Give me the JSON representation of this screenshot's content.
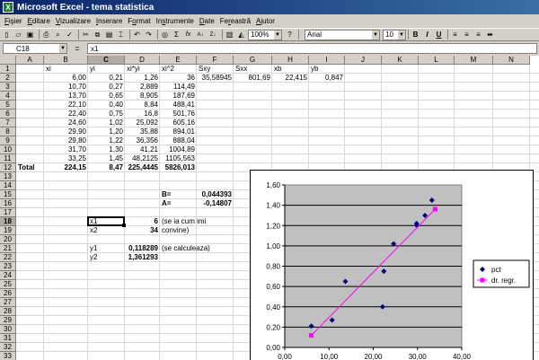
{
  "window": {
    "title": "Microsoft Excel - tema statistica",
    "app_icon": "excel-logo-icon"
  },
  "menu": [
    {
      "label": "Fişier",
      "u": "F"
    },
    {
      "label": "Editare",
      "u": "E"
    },
    {
      "label": "Vizualizare",
      "u": "V"
    },
    {
      "label": "Inserare",
      "u": "I"
    },
    {
      "label": "Format",
      "u": "o"
    },
    {
      "label": "Instrumente",
      "u": "s"
    },
    {
      "label": "Date",
      "u": "D"
    },
    {
      "label": "Fereastră",
      "u": "r"
    },
    {
      "label": "Ajutor",
      "u": "A"
    }
  ],
  "toolbar": {
    "zoom": "100%",
    "font_name": "Arial",
    "font_size": "10",
    "bold_label": "B",
    "italic_label": "I",
    "underline_label": "U",
    "sum_label": "Σ",
    "fx_label": "fx",
    "sort_asc_label": "A↓",
    "sort_desc_label": "Z↓"
  },
  "formula_bar": {
    "name_box": "C18",
    "fx_symbol": "=",
    "content": "x1"
  },
  "sheet": {
    "columns": [
      "A",
      "B",
      "C",
      "D",
      "E",
      "F",
      "G",
      "H",
      "I",
      "J",
      "K",
      "L",
      "M",
      "N"
    ],
    "selected_column": "C",
    "selected_row": "18",
    "rows": [
      "1",
      "2",
      "3",
      "4",
      "5",
      "6",
      "7",
      "8",
      "9",
      "10",
      "11",
      "12",
      "13",
      "14",
      "15",
      "16",
      "17",
      "18",
      "19",
      "20",
      "21",
      "22",
      "23",
      "24",
      "25",
      "26",
      "27",
      "28",
      "29",
      "30",
      "31",
      "32",
      "33"
    ],
    "cells": [
      {
        "col": "B",
        "row": 1,
        "v": "xi"
      },
      {
        "col": "C",
        "row": 1,
        "v": "yi"
      },
      {
        "col": "D",
        "row": 1,
        "v": "xi*yi"
      },
      {
        "col": "E",
        "row": 1,
        "v": "xi^2"
      },
      {
        "col": "F",
        "row": 1,
        "v": "Sxy"
      },
      {
        "col": "G",
        "row": 1,
        "v": "Sxx"
      },
      {
        "col": "H",
        "row": 1,
        "v": "xb"
      },
      {
        "col": "I",
        "row": 1,
        "v": "yb"
      },
      {
        "col": "B",
        "row": 2,
        "v": "6,00",
        "r": 1
      },
      {
        "col": "C",
        "row": 2,
        "v": "0,21",
        "r": 1
      },
      {
        "col": "D",
        "row": 2,
        "v": "1,26",
        "r": 1
      },
      {
        "col": "E",
        "row": 2,
        "v": "36",
        "r": 1
      },
      {
        "col": "F",
        "row": 2,
        "v": "35,58945",
        "r": 1
      },
      {
        "col": "G",
        "row": 2,
        "v": "801,69",
        "r": 1
      },
      {
        "col": "H",
        "row": 2,
        "v": "22,415",
        "r": 1
      },
      {
        "col": "I",
        "row": 2,
        "v": "0,847",
        "r": 1
      },
      {
        "col": "B",
        "row": 3,
        "v": "10,70",
        "r": 1
      },
      {
        "col": "C",
        "row": 3,
        "v": "0,27",
        "r": 1
      },
      {
        "col": "D",
        "row": 3,
        "v": "2,889",
        "r": 1
      },
      {
        "col": "E",
        "row": 3,
        "v": "114,49",
        "r": 1
      },
      {
        "col": "B",
        "row": 4,
        "v": "13,70",
        "r": 1
      },
      {
        "col": "C",
        "row": 4,
        "v": "0,65",
        "r": 1
      },
      {
        "col": "D",
        "row": 4,
        "v": "8,905",
        "r": 1
      },
      {
        "col": "E",
        "row": 4,
        "v": "187,69",
        "r": 1
      },
      {
        "col": "B",
        "row": 5,
        "v": "22,10",
        "r": 1
      },
      {
        "col": "C",
        "row": 5,
        "v": "0,40",
        "r": 1
      },
      {
        "col": "D",
        "row": 5,
        "v": "8,84",
        "r": 1
      },
      {
        "col": "E",
        "row": 5,
        "v": "488,41",
        "r": 1
      },
      {
        "col": "B",
        "row": 6,
        "v": "22,40",
        "r": 1
      },
      {
        "col": "C",
        "row": 6,
        "v": "0,75",
        "r": 1
      },
      {
        "col": "D",
        "row": 6,
        "v": "16,8",
        "r": 1
      },
      {
        "col": "E",
        "row": 6,
        "v": "501,76",
        "r": 1
      },
      {
        "col": "B",
        "row": 7,
        "v": "24,60",
        "r": 1
      },
      {
        "col": "C",
        "row": 7,
        "v": "1,02",
        "r": 1
      },
      {
        "col": "D",
        "row": 7,
        "v": "25,092",
        "r": 1
      },
      {
        "col": "E",
        "row": 7,
        "v": "605,16",
        "r": 1
      },
      {
        "col": "B",
        "row": 8,
        "v": "29,90",
        "r": 1
      },
      {
        "col": "C",
        "row": 8,
        "v": "1,20",
        "r": 1
      },
      {
        "col": "D",
        "row": 8,
        "v": "35,88",
        "r": 1
      },
      {
        "col": "E",
        "row": 8,
        "v": "894,01",
        "r": 1
      },
      {
        "col": "B",
        "row": 9,
        "v": "29,80",
        "r": 1
      },
      {
        "col": "C",
        "row": 9,
        "v": "1,22",
        "r": 1
      },
      {
        "col": "D",
        "row": 9,
        "v": "36,356",
        "r": 1
      },
      {
        "col": "E",
        "row": 9,
        "v": "888,04",
        "r": 1
      },
      {
        "col": "B",
        "row": 10,
        "v": "31,70",
        "r": 1
      },
      {
        "col": "C",
        "row": 10,
        "v": "1,30",
        "r": 1
      },
      {
        "col": "D",
        "row": 10,
        "v": "41,21",
        "r": 1
      },
      {
        "col": "E",
        "row": 10,
        "v": "1004,89",
        "r": 1
      },
      {
        "col": "B",
        "row": 11,
        "v": "33,25",
        "r": 1
      },
      {
        "col": "C",
        "row": 11,
        "v": "1,45",
        "r": 1
      },
      {
        "col": "D",
        "row": 11,
        "v": "48,2125",
        "r": 1
      },
      {
        "col": "E",
        "row": 11,
        "v": "1105,563",
        "r": 1
      },
      {
        "col": "A",
        "row": 12,
        "v": "Total",
        "b": 1
      },
      {
        "col": "B",
        "row": 12,
        "v": "224,15",
        "r": 1,
        "b": 1
      },
      {
        "col": "C",
        "row": 12,
        "v": "8,47",
        "r": 1,
        "b": 1
      },
      {
        "col": "D",
        "row": 12,
        "v": "225,4445",
        "r": 1,
        "b": 1
      },
      {
        "col": "E",
        "row": 12,
        "v": "5826,013",
        "r": 1,
        "b": 1
      },
      {
        "col": "E",
        "row": 15,
        "v": "B=",
        "b": 1
      },
      {
        "col": "F",
        "row": 15,
        "v": "0,044393",
        "r": 1,
        "b": 1
      },
      {
        "col": "E",
        "row": 16,
        "v": "A=",
        "b": 1
      },
      {
        "col": "F",
        "row": 16,
        "v": "-0,14807",
        "r": 1,
        "b": 1
      },
      {
        "col": "C",
        "row": 18,
        "v": "x1"
      },
      {
        "col": "D",
        "row": 18,
        "v": "6",
        "r": 1,
        "b": 1
      },
      {
        "col": "E",
        "row": 18,
        "v": "(se ia cum imi"
      },
      {
        "col": "C",
        "row": 19,
        "v": "x2"
      },
      {
        "col": "D",
        "row": 19,
        "v": "34",
        "r": 1,
        "b": 1
      },
      {
        "col": "E",
        "row": 19,
        "v": "convine)"
      },
      {
        "col": "C",
        "row": 21,
        "v": "y1"
      },
      {
        "col": "D",
        "row": 21,
        "v": "0,118289",
        "r": 1,
        "b": 1
      },
      {
        "col": "E",
        "row": 21,
        "v": "(se calculeaza)"
      },
      {
        "col": "C",
        "row": 22,
        "v": "y2"
      },
      {
        "col": "D",
        "row": 22,
        "v": "1,361293",
        "r": 1,
        "b": 1
      }
    ]
  },
  "chart_data": {
    "type": "scatter",
    "series": [
      {
        "name": "pct",
        "color": "#000080",
        "marker": "diamond",
        "x": [
          6.0,
          10.7,
          13.7,
          22.1,
          22.4,
          24.6,
          29.9,
          29.8,
          31.7,
          33.25
        ],
        "y": [
          0.21,
          0.27,
          0.65,
          0.4,
          0.75,
          1.02,
          1.2,
          1.22,
          1.3,
          1.45
        ]
      },
      {
        "name": "dr. regr.",
        "color": "#ff00ff",
        "marker": "square",
        "line": true,
        "x": [
          6,
          34
        ],
        "y": [
          0.118289,
          1.361293
        ]
      }
    ],
    "xlim": [
      0,
      40
    ],
    "ylim": [
      0,
      1.6
    ],
    "x_ticks": [
      "0,00",
      "10,00",
      "20,00",
      "30,00",
      "40,00"
    ],
    "y_ticks": [
      "0,00",
      "0,20",
      "0,40",
      "0,60",
      "0,80",
      "1,00",
      "1,20",
      "1,40",
      "1,60"
    ],
    "grid": true,
    "plot_bg": "#c0c0c0",
    "legend": "right"
  }
}
